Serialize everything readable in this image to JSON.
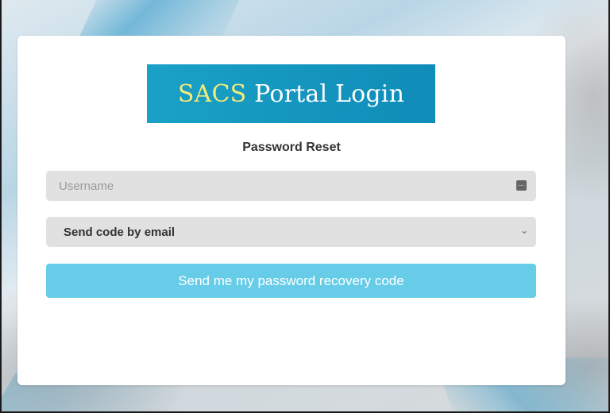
{
  "logo": {
    "accent_text": "SACS",
    "rest_text": " Portal Login"
  },
  "form": {
    "title": "Password Reset",
    "username_placeholder": "Username",
    "username_value": "",
    "method_select": {
      "selected": "Send code by email"
    },
    "submit_label": "Send me my password recovery code"
  },
  "icons": {
    "username_field_icon": "keyboard-icon",
    "select_caret": "chevron-down-icon"
  },
  "colors": {
    "logo_bg": "#1aa1c6",
    "logo_accent_text": "#f3ea7a",
    "button_bg": "#67cce8",
    "field_bg": "#e1e1e1"
  }
}
